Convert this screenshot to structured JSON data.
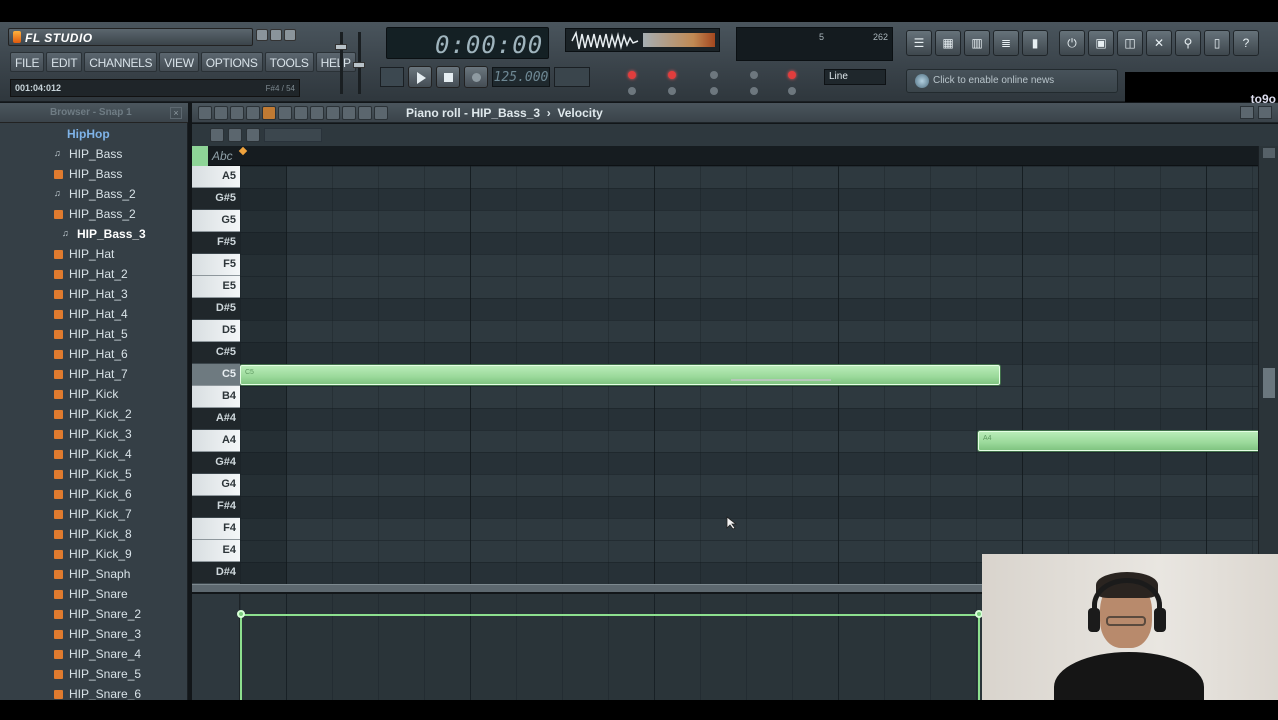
{
  "app": {
    "title": "FL STUDIO",
    "menu": [
      "FILE",
      "EDIT",
      "CHANNELS",
      "VIEW",
      "OPTIONS",
      "TOOLS",
      "HELP"
    ],
    "hint_position": "001:04:012",
    "hint_right": "F#4 / 54"
  },
  "transport": {
    "time": "0:00:00",
    "tempo": "125.000",
    "cpu_left": "5",
    "cpu_right": "262",
    "snap_mode": "Line"
  },
  "news": {
    "text": "Click to enable online news"
  },
  "corner_label": "to9o",
  "browser": {
    "title": "Browser - Snap 1",
    "items": [
      {
        "label": "HipHop",
        "kind": "folder"
      },
      {
        "label": "HIP_Bass",
        "kind": "synth"
      },
      {
        "label": "HIP_Bass",
        "kind": "sample"
      },
      {
        "label": "HIP_Bass_2",
        "kind": "synth"
      },
      {
        "label": "HIP_Bass_2",
        "kind": "sample"
      },
      {
        "label": "HIP_Bass_3",
        "kind": "selected"
      },
      {
        "label": "HIP_Hat",
        "kind": "sample"
      },
      {
        "label": "HIP_Hat_2",
        "kind": "sample"
      },
      {
        "label": "HIP_Hat_3",
        "kind": "sample"
      },
      {
        "label": "HIP_Hat_4",
        "kind": "sample"
      },
      {
        "label": "HIP_Hat_5",
        "kind": "sample"
      },
      {
        "label": "HIP_Hat_6",
        "kind": "sample"
      },
      {
        "label": "HIP_Hat_7",
        "kind": "sample"
      },
      {
        "label": "HIP_Kick",
        "kind": "sample"
      },
      {
        "label": "HIP_Kick_2",
        "kind": "sample"
      },
      {
        "label": "HIP_Kick_3",
        "kind": "sample"
      },
      {
        "label": "HIP_Kick_4",
        "kind": "sample"
      },
      {
        "label": "HIP_Kick_5",
        "kind": "sample"
      },
      {
        "label": "HIP_Kick_6",
        "kind": "sample"
      },
      {
        "label": "HIP_Kick_7",
        "kind": "sample"
      },
      {
        "label": "HIP_Kick_8",
        "kind": "sample"
      },
      {
        "label": "HIP_Kick_9",
        "kind": "sample"
      },
      {
        "label": "HIP_Snaph",
        "kind": "sample"
      },
      {
        "label": "HIP_Snare",
        "kind": "sample"
      },
      {
        "label": "HIP_Snare_2",
        "kind": "sample"
      },
      {
        "label": "HIP_Snare_3",
        "kind": "sample"
      },
      {
        "label": "HIP_Snare_4",
        "kind": "sample"
      },
      {
        "label": "HIP_Snare_5",
        "kind": "sample"
      },
      {
        "label": "HIP_Snare_6",
        "kind": "sample"
      }
    ]
  },
  "piano_roll": {
    "title": "Piano roll - HIP_Bass_3",
    "mode": "Velocity",
    "timeline_label": "Abc",
    "keys": [
      {
        "label": "A5",
        "black": false
      },
      {
        "label": "G#5",
        "black": true
      },
      {
        "label": "G5",
        "black": false
      },
      {
        "label": "F#5",
        "black": true
      },
      {
        "label": "F5",
        "black": false
      },
      {
        "label": "E5",
        "black": false
      },
      {
        "label": "D#5",
        "black": true
      },
      {
        "label": "D5",
        "black": false
      },
      {
        "label": "C#5",
        "black": true
      },
      {
        "label": "C5",
        "black": false
      },
      {
        "label": "B4",
        "black": false
      },
      {
        "label": "A#4",
        "black": true
      },
      {
        "label": "A4",
        "black": false
      },
      {
        "label": "G#4",
        "black": true
      },
      {
        "label": "G4",
        "black": false
      },
      {
        "label": "F#4",
        "black": true
      },
      {
        "label": "F4",
        "black": false
      },
      {
        "label": "E4",
        "black": false
      },
      {
        "label": "D#4",
        "black": true
      }
    ],
    "notes": [
      {
        "key": "C5",
        "label": "C5"
      },
      {
        "key": "A4",
        "label": "A4"
      }
    ]
  },
  "colors": {
    "note": "#9ad99a",
    "accent": "#f0a33d",
    "folder": "#7fb3e8"
  }
}
